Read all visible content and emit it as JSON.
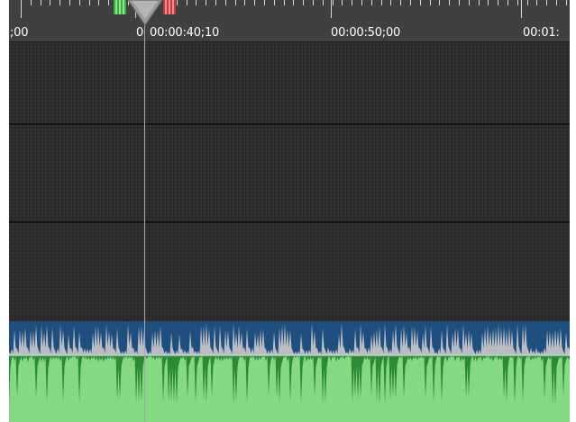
{
  "timeline": {
    "ruler_labels": [
      ";00",
      "00:00:40;10",
      "00:00:50;00",
      "00:01:"
    ],
    "playhead_label_prefix": "0"
  },
  "tracks": [
    {
      "type": "video"
    },
    {
      "type": "video"
    },
    {
      "type": "video"
    },
    {
      "type": "audio"
    }
  ],
  "colors": {
    "track_background": "#2a2a2a",
    "ruler_background": "#404040",
    "audio_upper": "#1f4f7f",
    "audio_lower": "#86d983",
    "waveform_upper": "#b9bdc2",
    "waveform_lower": "#2c8a36",
    "in_marker": "#3cae3c",
    "out_marker": "#c43b3b"
  }
}
